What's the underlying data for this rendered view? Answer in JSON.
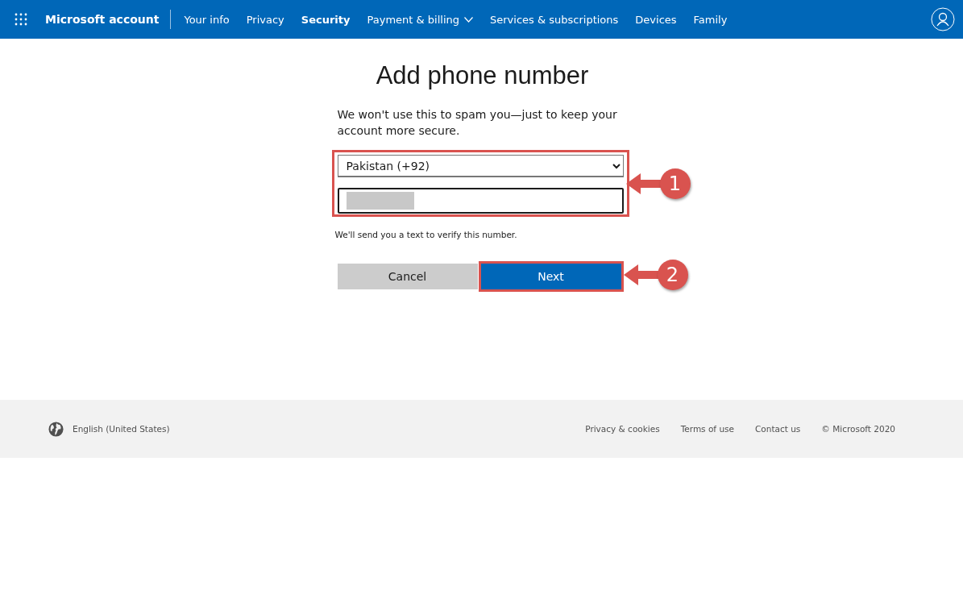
{
  "nav": {
    "brand": "Microsoft account",
    "items": [
      {
        "label": "Your info",
        "kind": "link",
        "selected": false
      },
      {
        "label": "Privacy",
        "kind": "link",
        "selected": false
      },
      {
        "label": "Security",
        "kind": "link",
        "selected": true
      },
      {
        "label": "Payment & billing",
        "kind": "dropdown",
        "selected": false
      },
      {
        "label": "Services & subscriptions",
        "kind": "link",
        "selected": false
      },
      {
        "label": "Devices",
        "kind": "link",
        "selected": false
      },
      {
        "label": "Family",
        "kind": "link",
        "selected": false
      }
    ]
  },
  "form": {
    "title": "Add phone number",
    "intro": "We won't use this to spam you—just to keep your account more secure.",
    "country_select": {
      "value": "Pakistan (+92)"
    },
    "phone_field": {
      "redacted": true
    },
    "fields_callout": "1",
    "hint": "We'll send you a text to verify this number.",
    "buttons": [
      {
        "label": "Cancel",
        "kind": "secondary"
      },
      {
        "label": "Next",
        "kind": "primary",
        "callout": "2"
      }
    ]
  },
  "footer": {
    "language": "English (United States)",
    "links": [
      "Privacy & cookies",
      "Terms of use",
      "Contact us"
    ],
    "copyright": "© Microsoft 2020"
  }
}
